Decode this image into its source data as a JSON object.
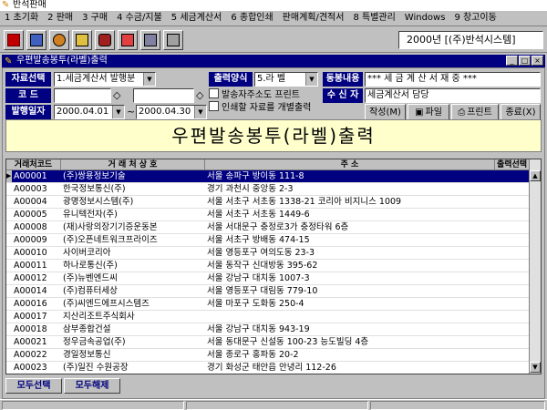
{
  "app": {
    "title": "반석판매"
  },
  "menu": [
    "1 초기화",
    "2 판매",
    "3 구매",
    "4 수금/지불",
    "5 세금계산서",
    "6 종합인쇄",
    "판매계획/견적서",
    "8 특별관리",
    "Windows",
    "9 창고이동"
  ],
  "toolbar": {
    "icons": [
      "door-icon",
      "tree-icon",
      "globe-icon",
      "pencil-icon",
      "database-icon",
      "palette-icon",
      "calculator-icon",
      "printer-icon"
    ],
    "company": "2000년 [(주)반석시스템]"
  },
  "window": {
    "title": "우편발송봉투(라벨)출력"
  },
  "form": {
    "data_select_label": "자료선택",
    "data_select_value": "1.세금계산서 발행분",
    "output_mode_label": "출력양식",
    "output_mode_value": "5.라 벨",
    "enclosure_label": "동봉내용",
    "enclosure_value": "*** 세 금 계 산 서 재 중 ***",
    "receiver_label": "수 신 자",
    "receiver_value": "세금계산서 담당",
    "code_label": "코 드",
    "code_from": "",
    "code_to": "",
    "date_label": "발행일자",
    "date_from": "2000.04.01",
    "date_sep": "~",
    "date_to": "2000.04.30",
    "print_sender_label": "발송자주소도 프린트",
    "print_individual_label": "인쇄할 자료를 개별출력"
  },
  "buttons": {
    "compose": "작성(M)",
    "file": "파일",
    "print": "프린트",
    "exit": "종료(X)"
  },
  "banner": {
    "text": "우편발송봉투(라벨)출력"
  },
  "table": {
    "headers": [
      "거래처코드",
      "거 래 처 상 호",
      "주 소",
      "출력선택"
    ],
    "rows": [
      {
        "code": "A00001",
        "name": "(주)쌍용정보기술",
        "addr": "서울 송파구 방이동 111-8"
      },
      {
        "code": "A00003",
        "name": "한국정보통신(주)",
        "addr": "경기 과천시 중앙동 2-3"
      },
      {
        "code": "A00004",
        "name": "광명정보시스템(주)",
        "addr": "서울 서초구 서초동 1338-21 코리아 비지니스 1009"
      },
      {
        "code": "A00005",
        "name": "유니텍전자(주)",
        "addr": "서울 서초구 서초동 1449-6"
      },
      {
        "code": "A00008",
        "name": "(재)사랑의장기기증운동본",
        "addr": "서울 서대문구 충정로3가 충정타워 6층"
      },
      {
        "code": "A00009",
        "name": "(주)오픈네트워크프라이즈",
        "addr": "서울 서초구 방배동 474-15"
      },
      {
        "code": "A00010",
        "name": "사이버코리아",
        "addr": "서울 영등포구 여의도동 23-3"
      },
      {
        "code": "A00011",
        "name": "하나로통신(주)",
        "addr": "서울 동작구 신대방동 395-62"
      },
      {
        "code": "A00012",
        "name": "(주)뉴벤엔드씨",
        "addr": "서울 강남구 대치동 1007-3"
      },
      {
        "code": "A00014",
        "name": "(주)컴퓨터세상",
        "addr": "서울 영등포구 대림동 779-10"
      },
      {
        "code": "A00016",
        "name": "(주)씨엔드에프시스템즈",
        "addr": "서울 마포구 도화동 250-4"
      },
      {
        "code": "A00017",
        "name": "지산리조트주식회사",
        "addr": ""
      },
      {
        "code": "A00018",
        "name": "삼부종합건설",
        "addr": "서울 강남구 대치동 943-19"
      },
      {
        "code": "A00021",
        "name": "정우금속공업(주)",
        "addr": "서울 동대문구 신설동 100-23 능도빌딩 4층"
      },
      {
        "code": "A00022",
        "name": "경일정보통신",
        "addr": "서울 종로구 홍파동 20-2"
      },
      {
        "code": "A00023",
        "name": "(주)일진 수원공장",
        "addr": "경기 화성군 태안읍 안녕리 112-26"
      }
    ],
    "selected_index": 0
  },
  "bottom": {
    "select_all": "모두선택",
    "deselect_all": "모두해제"
  }
}
